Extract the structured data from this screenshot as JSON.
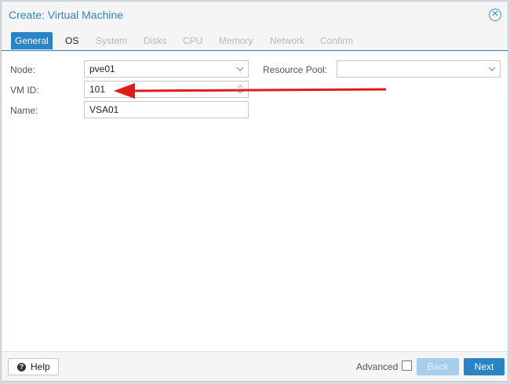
{
  "dialog": {
    "title": "Create: Virtual Machine"
  },
  "tabs": [
    {
      "label": "General",
      "state": "active"
    },
    {
      "label": "OS",
      "state": "enabled"
    },
    {
      "label": "System",
      "state": "disabled"
    },
    {
      "label": "Disks",
      "state": "disabled"
    },
    {
      "label": "CPU",
      "state": "disabled"
    },
    {
      "label": "Memory",
      "state": "disabled"
    },
    {
      "label": "Network",
      "state": "disabled"
    },
    {
      "label": "Confirm",
      "state": "disabled"
    }
  ],
  "form": {
    "node_label": "Node:",
    "node_value": "pve01",
    "vmid_label": "VM ID:",
    "vmid_value": "101",
    "name_label": "Name:",
    "name_value": "VSA01",
    "pool_label": "Resource Pool:",
    "pool_value": ""
  },
  "footer": {
    "help_label": "Help",
    "advanced_label": "Advanced",
    "advanced_checked": false,
    "back_label": "Back",
    "next_label": "Next"
  },
  "annotation": {
    "arrow_color": "#e01b1b"
  },
  "colors": {
    "accent": "#2a83c4",
    "title": "#2f84bf"
  }
}
